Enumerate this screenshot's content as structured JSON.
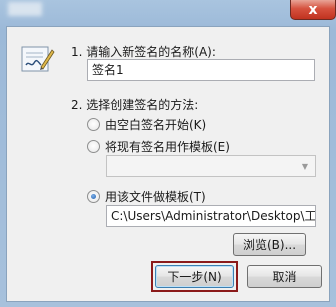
{
  "dialog": {
    "close_glyph": "x"
  },
  "step1": {
    "label": "1. 请输入新签名的名称(A):",
    "name_value": "签名1"
  },
  "step2": {
    "label": "2. 选择创建签名的方法:",
    "options": [
      {
        "label": "由空白签名开始(K)",
        "checked": false
      },
      {
        "label": "将现有签名用作模板(E)",
        "checked": false
      },
      {
        "label": "用该文件做模板(T)",
        "checked": true
      }
    ],
    "template_dropdown_value": "",
    "file_path": "C:\\Users\\Administrator\\Desktop\\工作"
  },
  "buttons": {
    "browse": "浏览(B)...",
    "next": "下一步(N)",
    "cancel": "取消"
  },
  "colors": {
    "highlight": "#8b1a1a",
    "radio_selected": "#1e5fae"
  }
}
